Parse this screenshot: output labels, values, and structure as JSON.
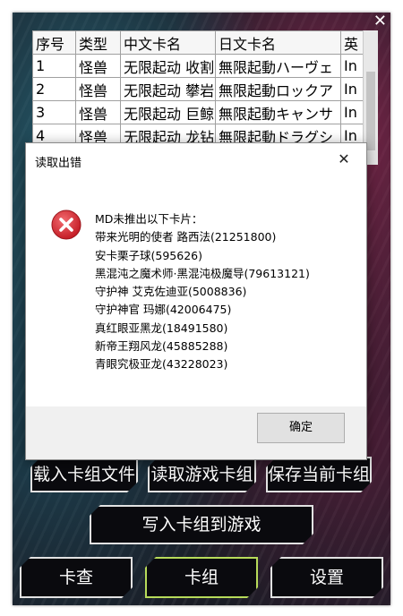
{
  "window": {
    "close_glyph": "✕"
  },
  "card_table": {
    "columns": [
      "序号",
      "类型",
      "中文卡名",
      "日文卡名",
      "英"
    ],
    "rows": [
      [
        "1",
        "怪兽",
        "无限起动 收割",
        "無限起動ハーヴェ",
        "In"
      ],
      [
        "2",
        "怪兽",
        "无限起动 攀岩",
        "無限起動ロックア",
        "In"
      ],
      [
        "3",
        "怪兽",
        "无限起动 巨鲸",
        "無限起動キャンサ",
        "In"
      ],
      [
        "4",
        "怪兽",
        "无限起动 龙钻",
        "無限起動ドラグシ",
        "In"
      ]
    ]
  },
  "buttons": {
    "load_deck_file": "载入卡组文件",
    "read_game_deck": "读取游戏卡组",
    "save_current_deck": "保存当前卡组",
    "write_deck_to_game": "写入卡组到游戏",
    "card_lookup": "卡查",
    "deck": "卡组",
    "settings": "设置"
  },
  "dialog": {
    "title": "读取出错",
    "close_glyph": "✕",
    "icon": "error-x-icon",
    "message_lines": [
      "MD未推出以下卡片：",
      "带来光明的使者 路西法(21251800)",
      "安卡栗子球(595626)",
      "黑混沌之魔术师·黑混沌极魔导(79613121)",
      "守护神 艾克佐迪亚(5008836)",
      "守护神官 玛娜(42006475)",
      "真红眼亚黑龙(18491580)",
      "新帝王翔风龙(45885288)",
      "青眼究极亚龙(43228023)"
    ],
    "ok_label": "确定"
  },
  "colors": {
    "highlight_border": "#b7db5a",
    "error_red": "#d9262e"
  }
}
